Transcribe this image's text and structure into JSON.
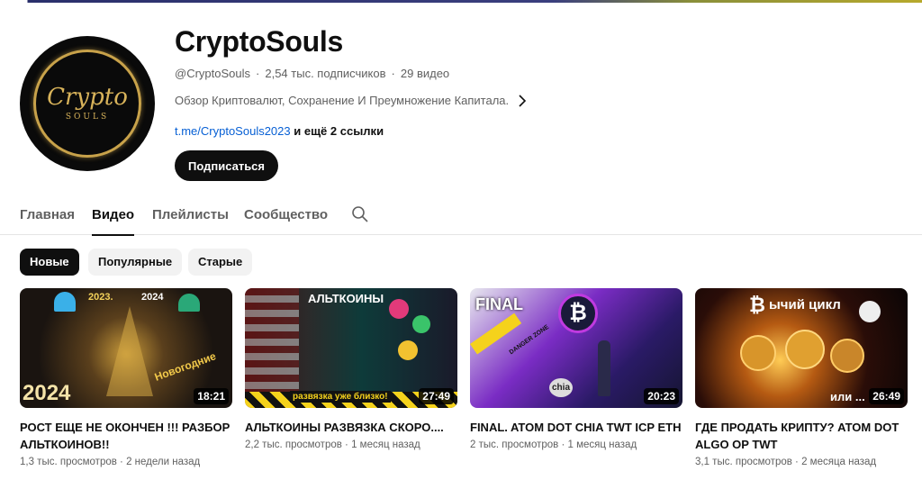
{
  "channel": {
    "name": "CryptoSouls",
    "handle": "@CryptoSouls",
    "subscribers": "2,54 тыс. подписчиков",
    "videos_count": "29 видео",
    "separator": "·",
    "description": "Обзор Криптовалют, Сохранение И Преумножение Капитала.",
    "link": "t.me/CryptoSouls2023",
    "more_links": "и ещё 2 ссылки",
    "subscribe_label": "Подписаться",
    "avatar_script": "Crypto",
    "avatar_sub": "SOULS"
  },
  "tabs": [
    {
      "label": "Главная"
    },
    {
      "label": "Видео"
    },
    {
      "label": "Плейлисты"
    },
    {
      "label": "Сообщество"
    }
  ],
  "chips": [
    {
      "label": "Новые"
    },
    {
      "label": "Популярные"
    },
    {
      "label": "Старые"
    }
  ],
  "videos": [
    {
      "title": "РОСТ ЕЩЕ НЕ ОКОНЧЕН !!! РАЗБОР АЛЬТКОИНОВ!!",
      "views": "1,3 тыс. просмотров",
      "age": "2 недели назад",
      "duration": "18:21",
      "overlay_top_left": "2023.",
      "overlay_top_right": "2024",
      "overlay_bottom": "2024",
      "overlay_side": "Новогодние"
    },
    {
      "title": "АЛЬТКОИНЫ РАЗВЯЗКА СКОРО....",
      "views": "2,2 тыс. просмотров",
      "age": "1 месяц назад",
      "duration": "27:49",
      "overlay_top": "АЛЬТКОИНЫ",
      "overlay_bottom": "развязка уже близко!"
    },
    {
      "title": "FINAL. ATOM DOT CHIA TWT ICP ETH",
      "views": "2 тыс. просмотров",
      "age": "1 месяц назад",
      "duration": "20:23",
      "overlay_top": "FINAL",
      "overlay_tape": "DANGER ZONE",
      "overlay_coin": "chia"
    },
    {
      "title": "ГДЕ ПРОДАТЬ КРИПТУ? ATOM DOT ALGO OP TWT",
      "views": "3,1 тыс. просмотров",
      "age": "2 месяца назад",
      "duration": "26:49",
      "overlay_top": "ычий цикл",
      "overlay_bottom": "или ..."
    }
  ]
}
